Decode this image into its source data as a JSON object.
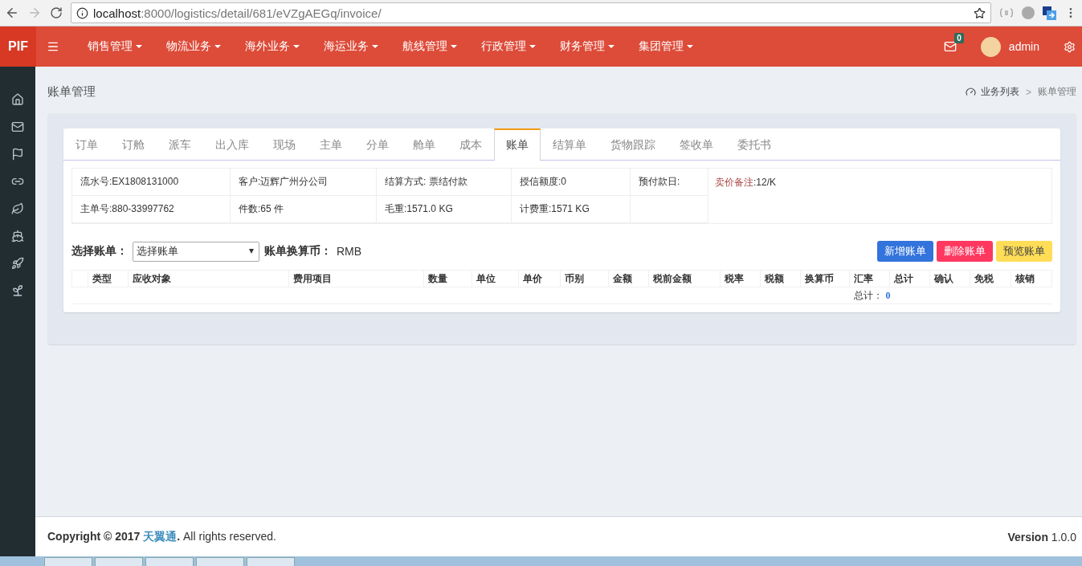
{
  "browser": {
    "url_host": "localhost",
    "url_path": ":8000/logistics/detail/681/eVZgAEGq/invoice/",
    "forward_disabled": true
  },
  "navbar": {
    "brand": "PIF",
    "menu": [
      "销售管理",
      "物流业务",
      "海外业务",
      "海运业务",
      "航线管理",
      "行政管理",
      "财务管理",
      "集团管理"
    ],
    "mail_count": "0",
    "user": "admin"
  },
  "page": {
    "title": "账单管理",
    "breadcrumb": [
      "业务列表",
      "账单管理"
    ],
    "breadcrumb_separator": ">"
  },
  "tabs": [
    {
      "label": "订单",
      "selected": false
    },
    {
      "label": "订舱",
      "selected": false
    },
    {
      "label": "派车",
      "selected": false
    },
    {
      "label": "出入库",
      "selected": false
    },
    {
      "label": "现场",
      "selected": false
    },
    {
      "label": "主单",
      "selected": false
    },
    {
      "label": "分单",
      "selected": false
    },
    {
      "label": "舱单",
      "selected": false
    },
    {
      "label": "成本",
      "selected": false
    },
    {
      "label": "账单",
      "selected": true
    },
    {
      "label": "结算单",
      "selected": false
    },
    {
      "label": "货物跟踪",
      "selected": false
    },
    {
      "label": "签收单",
      "selected": false
    },
    {
      "label": "委托书",
      "selected": false
    }
  ],
  "info": {
    "rows": [
      [
        {
          "label": "流水号:",
          "value": "EX1808131000"
        },
        {
          "label": "客户:",
          "value": "迈辉广州分公司"
        },
        {
          "label": "结算方式:",
          "value": " 票结付款"
        },
        {
          "label": "授信额度:",
          "value": "0"
        },
        {
          "label": "预付款日:"
        }
      ],
      [
        {
          "label": "主单号:",
          "value": "880-33997762"
        },
        {
          "label": "件数:",
          "value": "65 件"
        },
        {
          "label": "毛重:",
          "value": "1571.0 KG"
        },
        {
          "label": "计费重:",
          "value": "1571 KG"
        }
      ]
    ],
    "remark": {
      "label": "卖价备注",
      "value": ":12/K"
    }
  },
  "bill": {
    "select_label": "选择账单：",
    "select_value": "选择账单",
    "currency_label": "账单换算币：",
    "currency": "RMB",
    "buttons": [
      {
        "label": "新增账单",
        "kind": "primary"
      },
      {
        "label": "删除账单",
        "kind": "danger"
      },
      {
        "label": "预览账单",
        "kind": "warning"
      }
    ]
  },
  "table": {
    "columns": [
      "",
      "类型",
      "应收对象",
      "费用项目",
      "数量",
      "单位",
      "单价",
      "币别",
      "金额",
      "税前金额",
      "税率",
      "税额",
      "换算币",
      "汇率",
      "总计",
      "确认",
      "免税",
      "核销"
    ],
    "total_label": "总计：",
    "total_value": "0"
  },
  "footer": {
    "copyright_prefix": "Copyright © 2017 ",
    "company": "天翼通",
    "copyright_suffix": ". All rights reserved.",
    "version": "**Version** 1.0.0"
  }
}
